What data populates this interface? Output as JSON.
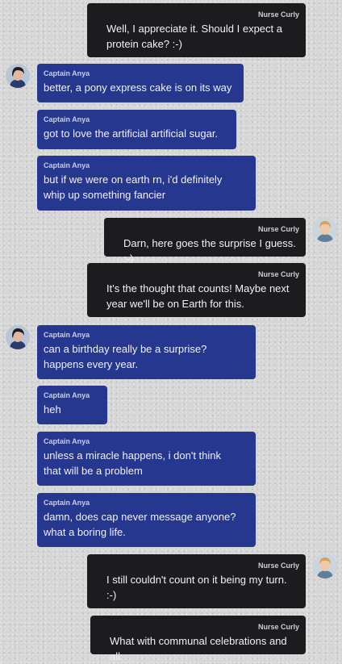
{
  "chat": {
    "messages": [
      {
        "sender": "Nurse Curly",
        "text": "Well, I appreciate it. Should I expect a\nprotein cake? :-)"
      },
      {
        "sender": "Captain Anya",
        "text": "better, a pony express cake is on its way"
      },
      {
        "sender": "Captain Anya",
        "text": "got to love the artificial artificial sugar."
      },
      {
        "sender": "Captain Anya",
        "text": "but if we were on earth rn, i'd definitely\nwhip up something fancier"
      },
      {
        "sender": "Nurse Curly",
        "text": "Darn, here goes the surprise I guess. :-)"
      },
      {
        "sender": "Nurse Curly",
        "text": "It's the thought that counts! Maybe next\nyear we'll be on Earth for this."
      },
      {
        "sender": "Captain Anya",
        "text": "can a birthday really be a surprise?\nhappens every year."
      },
      {
        "sender": "Captain Anya",
        "text": "heh"
      },
      {
        "sender": "Captain Anya",
        "text": "unless a miracle happens, i don't think\nthat will be a problem"
      },
      {
        "sender": "Captain Anya",
        "text": "damn, does cap never message anyone?\nwhat a boring life."
      },
      {
        "sender": "Nurse Curly",
        "text": "I still couldn't count on it being my turn.\n:-)"
      },
      {
        "sender": "Nurse Curly",
        "text": "What with communal celebrations and all."
      }
    ]
  }
}
